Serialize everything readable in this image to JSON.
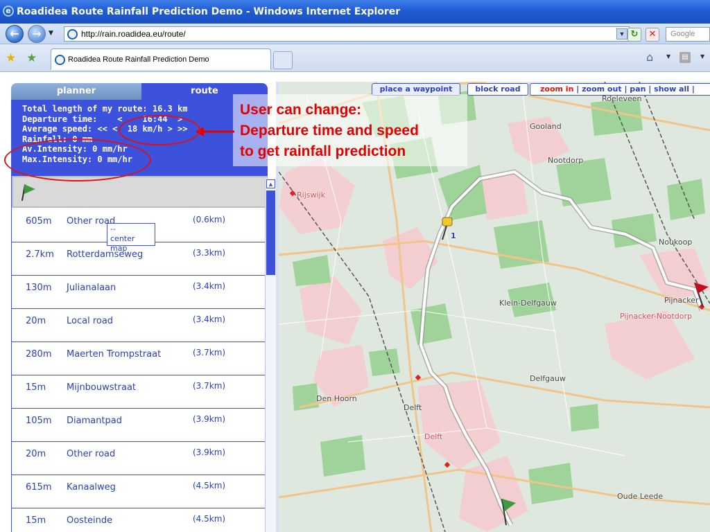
{
  "window": {
    "title": "Roadidea Route Rainfall Prediction Demo - Windows Internet Explorer",
    "url": "http://rain.roadidea.eu/route/",
    "search_placeholder": "Google",
    "tab_title": "Roadidea Route Rainfall Prediction Demo"
  },
  "planner": {
    "tab_planner": "planner",
    "tab_route": "route",
    "info": {
      "total_length": "Total length of my route: 16.3 km",
      "departure_label": "Departure time:",
      "departure_value": "16:44",
      "speed_label": "Average speed:",
      "speed_value": "18 km/h",
      "rainfall": "Rainfall: 0 mm",
      "av_intensity": "Av.Intensity: 0 mm/hr",
      "max_intensity": "Max.Intensity: 0 mm/hr"
    },
    "tooltip": "--\ncenter map",
    "route_steps": [
      {
        "dist": "605m",
        "road": "Other road",
        "cum": "(0.6km)"
      },
      {
        "dist": "2.7km",
        "road": "Rotterdamseweg",
        "cum": "(3.3km)"
      },
      {
        "dist": "130m",
        "road": "Julianalaan",
        "cum": "(3.4km)"
      },
      {
        "dist": "20m",
        "road": "Local road",
        "cum": "(3.4km)"
      },
      {
        "dist": "280m",
        "road": "Maerten Trompstraat",
        "cum": "(3.7km)"
      },
      {
        "dist": "15m",
        "road": "Mijnbouwstraat",
        "cum": "(3.7km)"
      },
      {
        "dist": "105m",
        "road": "Diamantpad",
        "cum": "(3.9km)"
      },
      {
        "dist": "20m",
        "road": "Other road",
        "cum": "(3.9km)"
      },
      {
        "dist": "615m",
        "road": "Kanaalweg",
        "cum": "(4.5km)"
      },
      {
        "dist": "15m",
        "road": "Oosteinde",
        "cum": "(4.5km)"
      }
    ]
  },
  "map": {
    "toolbar": {
      "place_waypoint": "place a waypoint",
      "block_road": "block road",
      "zoom_in": "zoom in",
      "zoom_out": "zoom out",
      "pan": "pan",
      "show_all": "show all"
    },
    "labels": {
      "roeleveen": "Roeleveen",
      "gooland": "Gooland",
      "nootdorp": "Nootdorp",
      "rijswijk": "Rijswijk",
      "noukoop": "Noukoop",
      "pijnacker": "Pijnacker",
      "pijnacker_nootdorp": "Pijnacker-Nootdorp",
      "klein_delfgauw": "Klein-Delfgauw",
      "delfgauw": "Delfgauw",
      "den_hoorn": "Den Hoorn",
      "delft": "Delft",
      "delft_red": "Delft",
      "oude_leede": "Oude Leede",
      "waypoint_number": "1"
    },
    "colors": {
      "green": "#9fd39a",
      "urban": "#f4c2c6",
      "background": "#dfe8de",
      "route": "#ffffff"
    }
  },
  "annotation": {
    "line1": "User can change:",
    "line2": "Departure time and speed",
    "line3": "to get rainfall prediction",
    "color": "#e10000"
  }
}
